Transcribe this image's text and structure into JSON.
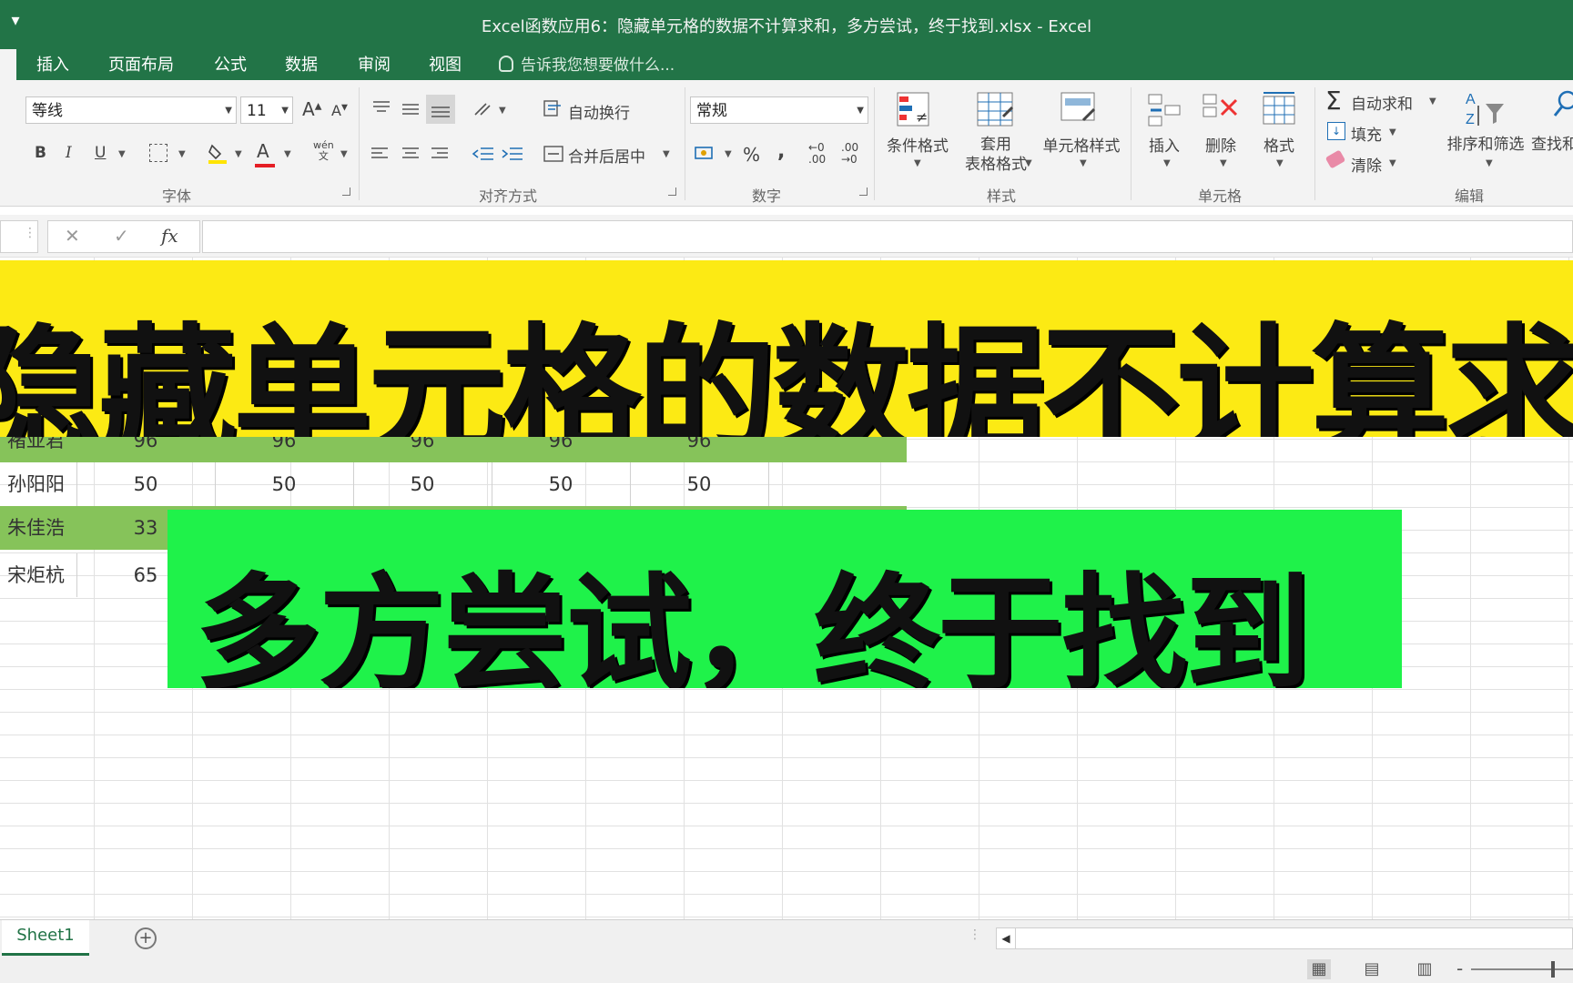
{
  "window": {
    "title": "Excel函数应用6：隐藏单元格的数据不计算求和，多方尝试，终于找到.xlsx - Excel",
    "quick_access": "▾"
  },
  "tabs": [
    "插入",
    "页面布局",
    "公式",
    "数据",
    "审阅",
    "视图"
  ],
  "tell_me": "告诉我您想要做什么...",
  "ribbon": {
    "font": {
      "name": "等线",
      "size": "11",
      "grow": "A",
      "shrink": "A",
      "bold": "B",
      "italic": "I",
      "underline": "U",
      "font_color_glyph": "A",
      "phonetic": "wén",
      "phonetic_sub": "文",
      "label": "字体"
    },
    "alignment": {
      "wrap": "自动换行",
      "merge": "合并后居中",
      "label": "对齐方式"
    },
    "number": {
      "format": "常规",
      "percent": "%",
      "comma": ",",
      "inc": "←0 .00",
      "dec": ".00 →0",
      "label": "数字"
    },
    "styles": {
      "conditional": "条件格式",
      "table_line1": "套用",
      "table_line2": "表格格式",
      "cell_styles": "单元格样式",
      "label": "样式"
    },
    "cells": {
      "insert": "插入",
      "delete": "删除",
      "format": "格式",
      "label": "单元格"
    },
    "editing": {
      "autosum": "自动求和",
      "fill": "填充",
      "clear": "清除",
      "sort": "排序和筛选",
      "find": "查找和",
      "label": "编辑"
    }
  },
  "formula_bar": {
    "cancel": "✕",
    "enter": "✓",
    "fx": "fx"
  },
  "rows": [
    {
      "name": "褚亚君",
      "values": [
        "96",
        "96",
        "96",
        "96",
        "96"
      ],
      "highlight": true
    },
    {
      "name": "孙阳阳",
      "values": [
        "50",
        "50",
        "50",
        "50",
        "50"
      ],
      "highlight": false
    },
    {
      "name": "朱佳浩",
      "values": [
        "33",
        "",
        "",
        "",
        ""
      ],
      "highlight": true
    },
    {
      "name": "宋炬杭",
      "values": [
        "65",
        "",
        "",
        "",
        ""
      ],
      "highlight": false
    }
  ],
  "banners": {
    "top": "隐藏单元格的数据不计算求和",
    "bottom": "多方尝试，终于找到"
  },
  "sheet_tab": "Sheet1",
  "add_sheet": "+",
  "scroll_left": "◀",
  "views": [
    "▦",
    "▤",
    "▥"
  ],
  "zoom_minus": "-",
  "colors": {
    "excel_green": "#227447",
    "yellow_banner": "#fcea14",
    "green_banner": "#1ff24a",
    "row_highlight": "#86c35a"
  }
}
